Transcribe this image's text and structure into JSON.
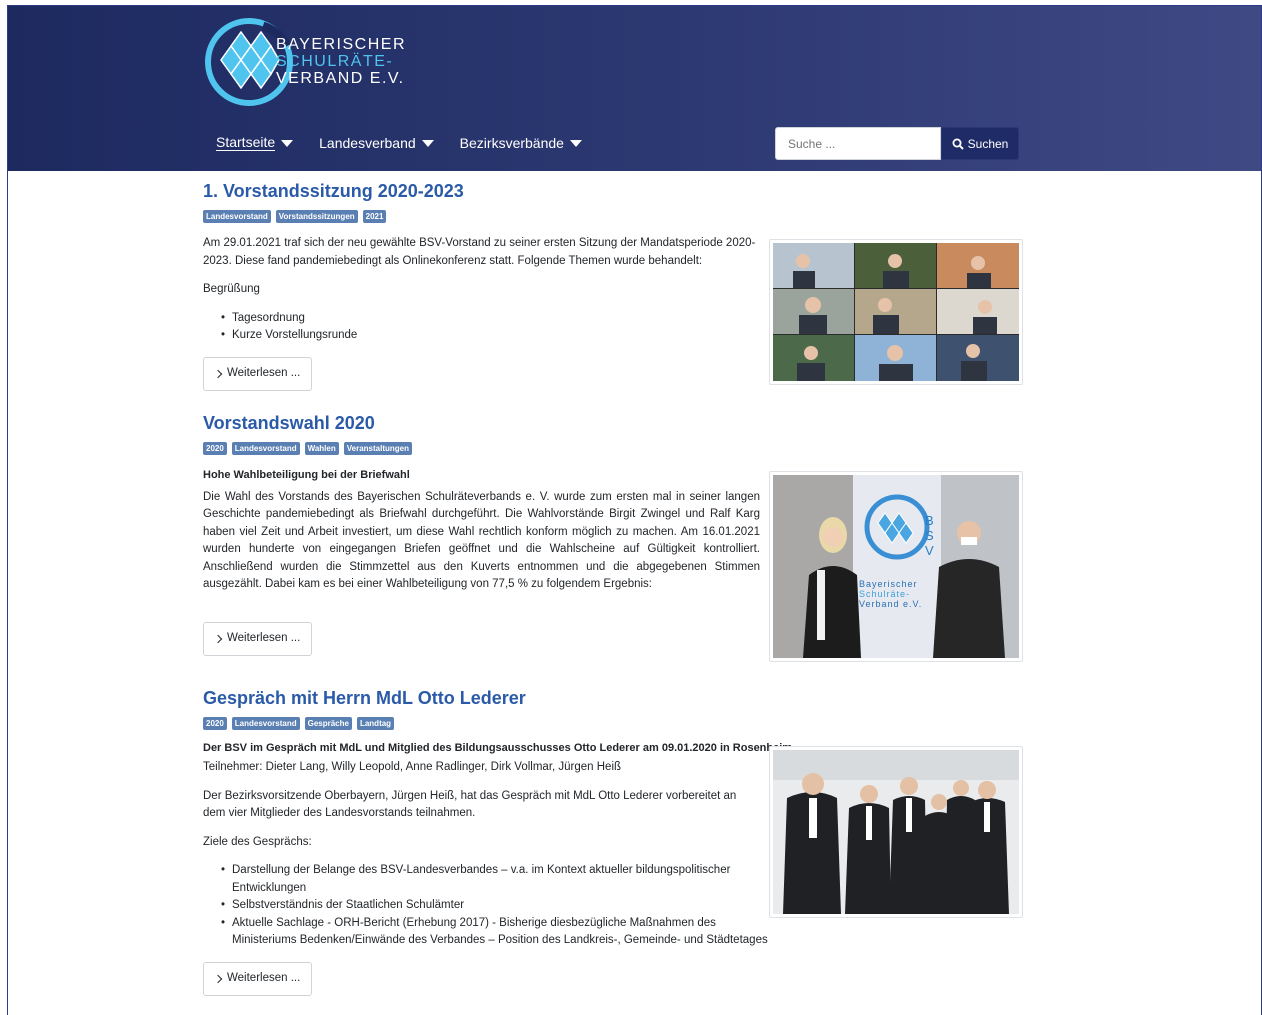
{
  "header": {
    "logo_lines": [
      "Bayerischer",
      "Schulräte-",
      "Verband e.V."
    ],
    "nav": [
      {
        "label": "Startseite"
      },
      {
        "label": "Landesverband"
      },
      {
        "label": "Bezirksverbände"
      }
    ],
    "search": {
      "placeholder": "Suche ...",
      "button_label": "Suchen"
    }
  },
  "articles": [
    {
      "title": "1. Vorstandssitzung 2020-2023",
      "tags": [
        "Landesvorstand",
        "Vorstandssitzungen",
        "2021"
      ],
      "paragraph1": "Am 29.01.2021 traf sich der neu gewählte BSV-Vorstand zu seiner ersten Sitzung der Mandatsperiode 2020-2023. Diese fand pandemiebedingt als Onlinekonferenz statt. Folgende Themen wurde behandelt:",
      "paragraph2": "Begrüßung",
      "list": [
        "Tagesordnung",
        "Kurze Vorstellungsrunde"
      ],
      "read_more": "Weiterlesen ..."
    },
    {
      "title": "Vorstandswahl 2020",
      "tags": [
        "2020",
        "Landesvorstand",
        "Wahlen",
        "Veranstaltungen"
      ],
      "lead": "Hohe Wahlbeteiligung bei der Briefwahl",
      "paragraph1": "Die Wahl des Vorstands des Bayerischen Schulräteverbands e. V. wurde zum ersten mal in seiner langen Geschichte pandemiebedingt als Briefwahl durchgeführt. Die Wahlvorstände Birgit Zwingel und Ralf Karg haben viel Zeit und Arbeit investiert, um diese Wahl rechtlich konform möglich zu machen. Am 16.01.2021 wurden hunderte von eingegangen Briefen geöffnet und die Wahlscheine auf Gültigkeit kontrolliert. Anschließend wurden die Stimmzettel aus den Kuverts entnommen und die abgegebenen Stimmen ausgezählt. Dabei kam es bei einer Wahlbeteiligung von 77,5 % zu folgendem Ergebnis:",
      "image_banner": [
        "B",
        "S",
        "V",
        "Bayerischer",
        "Schulräte-",
        "Verband e.V."
      ],
      "read_more": "Weiterlesen ..."
    },
    {
      "title": "Gespräch mit Herrn MdL Otto Lederer",
      "tags": [
        "2020",
        "Landesvorstand",
        "Gespräche",
        "Landtag"
      ],
      "lead": "Der BSV im Gespräch mit MdL und Mitglied des Bildungsausschusses Otto Lederer am 09.01.2020 in Rosenheim",
      "paragraph1": "Teilnehmer: Dieter Lang, Willy Leopold, Anne Radlinger, Dirk Vollmar, Jürgen Heiß",
      "paragraph2": "Der Bezirksvorsitzende Oberbayern, Jürgen Heiß, hat das Gespräch mit MdL Otto Lederer vorbereitet an dem vier Mitglieder des Landesvorstands teilnahmen.",
      "paragraph3": "Ziele des Gesprächs:",
      "list": [
        "Darstellung der Belange des BSV-Landesverbandes – v.a. im Kontext aktueller bildungspolitischer Entwicklungen",
        "Selbstverständnis der Staatlichen Schulämter",
        "Aktuelle Sachlage - ORH-Bericht (Erhebung 2017) - Bisherige diesbezügliche Maßnahmen des Ministeriums Bedenken/Einwände des Verbandes – Position des Landkreis-, Gemeinde- und Städtetages"
      ],
      "read_more": "Weiterlesen ..."
    }
  ],
  "icons": {
    "caret": "caret-down-icon",
    "search": "search-icon",
    "chevron": "chevron-right-icon"
  },
  "colors": {
    "header_bg": "#1d2a60",
    "accent_blue": "#2a5aa8",
    "tag_bg": "#5a7fb3",
    "logo_cyan": "#4ec4ee"
  }
}
